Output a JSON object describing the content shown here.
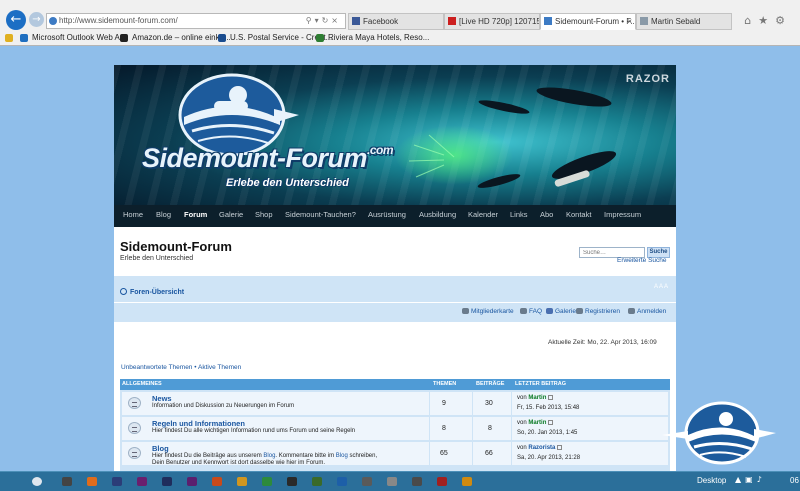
{
  "browser": {
    "address": "http://www.sidemount-forum.com/",
    "tabs": [
      {
        "label": "Facebook",
        "icon_color": "#3b5998",
        "active": false
      },
      {
        "label": "[Live HD 720p] 120715 - P...",
        "icon_color": "#cc1f1f",
        "active": false
      },
      {
        "label": "Sidemount-Forum • F...",
        "icon_color": "#3d7bc4",
        "active": true
      },
      {
        "label": "Martin Sebald",
        "icon_color": "#8a9aa8",
        "active": false
      }
    ],
    "favorites": [
      {
        "label": "Microsoft Outlook Web A...",
        "icon_color": "#1f6fc0"
      },
      {
        "label": "Amazon.de – online einka...",
        "icon_color": "#222222"
      },
      {
        "label": "U.S. Postal Service - Creat...",
        "icon_color": "#1a4c8f"
      },
      {
        "label": "Riviera Maya Hotels, Reso...",
        "icon_color": "#2e7d32"
      }
    ]
  },
  "banner": {
    "logo_text": "Sidemount-Forum",
    "logo_suffix": ".com",
    "tagline": "Erlebe den Unterschied",
    "sponsor": "RAZOR"
  },
  "menu": [
    {
      "label": "Home",
      "active": false
    },
    {
      "label": "Blog",
      "active": false
    },
    {
      "label": "Forum",
      "active": true
    },
    {
      "label": "Galerie",
      "active": false
    },
    {
      "label": "Shop",
      "active": false
    },
    {
      "label": "Sidemount-Tauchen?",
      "active": false
    },
    {
      "label": "Ausrüstung",
      "active": false
    },
    {
      "label": "Ausbildung",
      "active": false
    },
    {
      "label": "Kalender",
      "active": false
    },
    {
      "label": "Links",
      "active": false
    },
    {
      "label": "Abo",
      "active": false
    },
    {
      "label": "Kontakt",
      "active": false
    },
    {
      "label": "Impressum",
      "active": false
    }
  ],
  "header": {
    "title": "Sidemount-Forum",
    "subtitle": "Erlebe den Unterschied",
    "search_placeholder": "Suche…",
    "search_button": "Suche",
    "advanced_search": "Erweiterte Suche"
  },
  "breadcrumb": "Foren-Übersicht",
  "font_size_control": "A A A",
  "nav_links": [
    {
      "label": "Mitgliederkarte",
      "icon_color": "#6a7b8c"
    },
    {
      "label": "FAQ",
      "icon_color": "#6a7b8c"
    },
    {
      "label": "Galerie",
      "icon_color": "#4a6fb0"
    },
    {
      "label": "Registrieren",
      "icon_color": "#6a7b8c"
    },
    {
      "label": "Anmelden",
      "icon_color": "#6a7b8c"
    }
  ],
  "current_time": "Aktuelle Zeit: Mo, 22. Apr 2013, 16:09",
  "quick_links": {
    "unanswered": "Unbeantwortete Themen",
    "separator": "•",
    "active": "Aktive Themen"
  },
  "forum_table": {
    "columns": {
      "section": "ALLGEMEINES",
      "topics": "THEMEN",
      "posts": "BEITRÄGE",
      "last_post": "LETZTER BEITRAG"
    },
    "rows": [
      {
        "name": "News",
        "desc_lines": [
          [
            {
              "t": "Information und Diskussion zu Neuerungen im Forum"
            }
          ]
        ],
        "topics": "9",
        "posts": "30",
        "by_prefix": "von",
        "last_user": "Martin",
        "user_color": "green",
        "last_date": "Fr, 15. Feb 2013, 15:48"
      },
      {
        "name": "Regeln und Informationen",
        "desc_lines": [
          [
            {
              "t": "Hier findest Du alle wichtigen Information rund ums Forum und seine Regeln"
            }
          ]
        ],
        "topics": "8",
        "posts": "8",
        "by_prefix": "von",
        "last_user": "Martin",
        "user_color": "green",
        "last_date": "So, 20. Jan 2013, 1:45"
      },
      {
        "name": "Blog",
        "desc_lines": [
          [
            {
              "t": "Hier findest Du die Beiträge aus unserem "
            },
            {
              "t": "Blog",
              "link": true
            },
            {
              "t": ". Kommentare bitte im "
            },
            {
              "t": "Blog",
              "link": true
            },
            {
              "t": " schreiben,"
            }
          ],
          [
            {
              "t": "Dein Benutzer und Kennwort ist dort dasselbe wie hier im Forum."
            }
          ]
        ],
        "topics": "65",
        "posts": "66",
        "by_prefix": "von",
        "last_user": "Razorista",
        "user_color": "blue",
        "last_date": "Sa, 20. Apr 2013, 21:28"
      }
    ]
  },
  "taskbar": {
    "desktop_label": "Desktop",
    "clock": "06",
    "pins": [
      {
        "color": "#444444"
      },
      {
        "color": "#e06c1c"
      },
      {
        "color": "#2b3d78"
      },
      {
        "color": "#6a1f6e"
      },
      {
        "color": "#1f2d5c"
      },
      {
        "color": "#5b1f6e"
      },
      {
        "color": "#c84a1a"
      },
      {
        "color": "#d09620"
      },
      {
        "color": "#2d8a3c"
      },
      {
        "color": "#2a2a2a"
      },
      {
        "color": "#3a6a2a"
      },
      {
        "color": "#1d5fa8"
      },
      {
        "color": "#5a5a5a"
      },
      {
        "color": "#888888"
      },
      {
        "color": "#4a4a4a"
      },
      {
        "color": "#a02020"
      },
      {
        "color": "#d08a10"
      }
    ]
  }
}
